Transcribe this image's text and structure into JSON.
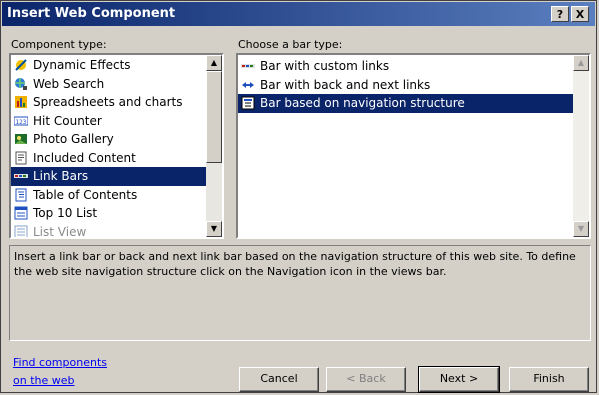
{
  "dialog": {
    "title": "Insert Web Component",
    "help_glyph": "?",
    "close_glyph": "X"
  },
  "component_types": {
    "label": "Component type:",
    "items": [
      {
        "label": "Dynamic Effects",
        "icon": "dynamic-effects-icon"
      },
      {
        "label": "Web Search",
        "icon": "web-search-icon"
      },
      {
        "label": "Spreadsheets and charts",
        "icon": "spreadsheet-icon"
      },
      {
        "label": "Hit Counter",
        "icon": "hit-counter-icon"
      },
      {
        "label": "Photo Gallery",
        "icon": "photo-gallery-icon"
      },
      {
        "label": "Included Content",
        "icon": "included-content-icon"
      },
      {
        "label": "Link Bars",
        "icon": "link-bars-icon",
        "selected": true
      },
      {
        "label": "Table of Contents",
        "icon": "table-of-contents-icon"
      },
      {
        "label": "Top 10 List",
        "icon": "top-10-list-icon"
      },
      {
        "label": "List View",
        "icon": "list-view-icon",
        "disabled": true
      }
    ]
  },
  "bar_types": {
    "label": "Choose a bar type:",
    "items": [
      {
        "label": "Bar with custom links",
        "icon": "custom-links-bar-icon"
      },
      {
        "label": "Bar with back and next links",
        "icon": "back-next-arrows-icon"
      },
      {
        "label": "Bar based on navigation structure",
        "icon": "navigation-structure-icon",
        "selected": true
      }
    ]
  },
  "description": "Insert a link bar or back and next link bar based on the navigation structure of this web site.  To define the web site navigation structure click on the Navigation icon in the views bar.",
  "find_link": {
    "line1": "Find components",
    "line2": "on the web"
  },
  "buttons": {
    "cancel": "Cancel",
    "back": "< Back",
    "next": "Next >",
    "finish": "Finish"
  },
  "colors": {
    "title_gradient_start": "#0a246a",
    "title_gradient_end": "#5a7fbf",
    "selection": "#0a246a",
    "face": "#d4d0c8",
    "link": "#0000ee"
  }
}
